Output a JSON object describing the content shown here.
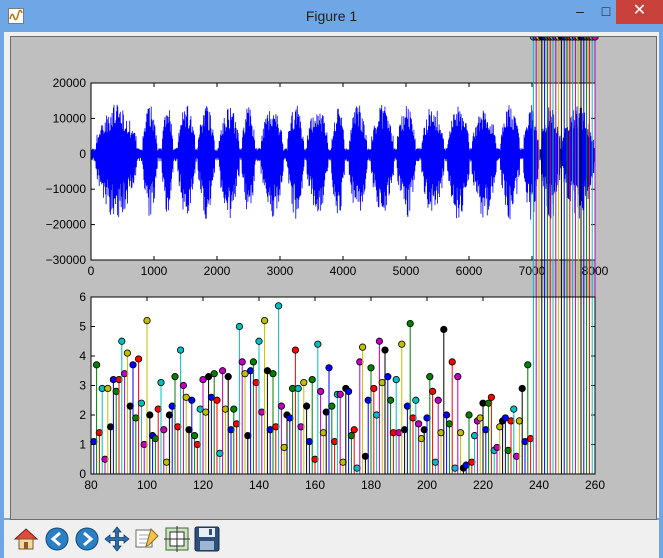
{
  "window": {
    "title": "Figure 1",
    "minimize": "–",
    "maximize": "□",
    "close": "✕"
  },
  "toolbar": {
    "buttons": [
      {
        "name": "home-button",
        "icon": "home-icon"
      },
      {
        "name": "back-button",
        "icon": "arrow-left-icon"
      },
      {
        "name": "forward-button",
        "icon": "arrow-right-icon"
      },
      {
        "name": "pan-button",
        "icon": "pan-cross-icon"
      },
      {
        "name": "zoom-button",
        "icon": "zoom-rect-icon"
      },
      {
        "name": "subplots-button",
        "icon": "subplots-icon"
      },
      {
        "name": "save-button",
        "icon": "floppy-disk-icon"
      }
    ]
  },
  "chart_data": [
    {
      "type": "line",
      "title": "",
      "xlabel": "",
      "ylabel": "",
      "xlim": [
        0,
        8000
      ],
      "ylim": [
        -30000,
        20000
      ],
      "xticks": [
        0,
        1000,
        2000,
        3000,
        4000,
        5000,
        6000,
        7000,
        8000
      ],
      "yticks": [
        20000,
        10000,
        0,
        -10000,
        -20000,
        -30000
      ],
      "xtick_labels": [
        "0",
        "1000",
        "2000",
        "3000",
        "4000",
        "5000",
        "6000",
        "7000",
        "8000"
      ],
      "ytick_labels": [
        "20000",
        "10000",
        "0",
        "−10000",
        "−20000",
        "−30000"
      ],
      "series": [
        {
          "color": "#0000ff"
        }
      ],
      "envelope_notes": "audio waveform roughly within −27000 to 15000 across 8000 samples",
      "grid": false
    },
    {
      "type": "scatter",
      "title": "",
      "xlabel": "",
      "ylabel": "",
      "xlim": [
        80,
        260
      ],
      "ylim": [
        0,
        6
      ],
      "xticks": [
        80,
        100,
        120,
        140,
        160,
        180,
        200,
        220,
        240,
        260
      ],
      "yticks": [
        0,
        1,
        2,
        3,
        4,
        5,
        6
      ],
      "xtick_labels": [
        "80",
        "100",
        "120",
        "140",
        "160",
        "180",
        "200",
        "220",
        "240",
        "260"
      ],
      "ytick_labels": [
        "0",
        "1",
        "2",
        "3",
        "4",
        "5",
        "6"
      ],
      "marker": "stem",
      "x": [
        81,
        82,
        83,
        84,
        85,
        86,
        87,
        88,
        89,
        90,
        91,
        92,
        93,
        94,
        95,
        96,
        97,
        98,
        99,
        100,
        101,
        102,
        103,
        104,
        105,
        106,
        107,
        108,
        109,
        110,
        111,
        112,
        113,
        114,
        115,
        116,
        117,
        118,
        119,
        120,
        121,
        122,
        123,
        124,
        125,
        126,
        127,
        128,
        129,
        130,
        131,
        132,
        133,
        134,
        135,
        136,
        137,
        138,
        139,
        140,
        141,
        142,
        143,
        144,
        145,
        146,
        147,
        148,
        149,
        150,
        151,
        152,
        153,
        154,
        155,
        156,
        157,
        158,
        159,
        160,
        161,
        162,
        163,
        164,
        165,
        166,
        167,
        168,
        169,
        170,
        171,
        172,
        173,
        174,
        175,
        176,
        177,
        178,
        179,
        180,
        181,
        182,
        183,
        184,
        185,
        186,
        187,
        188,
        189,
        190,
        191,
        192,
        193,
        194,
        195,
        196,
        197,
        198,
        199,
        200,
        201,
        202,
        203,
        204,
        205,
        206,
        207,
        208,
        209,
        210,
        211,
        212,
        213,
        214,
        215,
        216,
        217,
        218,
        219,
        220,
        221,
        222,
        223,
        224,
        225,
        226,
        227,
        228,
        229,
        230,
        231,
        232,
        233,
        234,
        235,
        236,
        237,
        238,
        239,
        240,
        241,
        242,
        243,
        244,
        245,
        246,
        247,
        248,
        249,
        250,
        251,
        252,
        253,
        254,
        255,
        256,
        257,
        258,
        259,
        260
      ],
      "values": [
        1.1,
        3.7,
        1.4,
        2.9,
        0.5,
        2.9,
        1.6,
        3.2,
        2.8,
        3.2,
        4.5,
        3.4,
        4.1,
        2.3,
        3.7,
        1.9,
        3.9,
        2.4,
        1.0,
        5.2,
        2.0,
        1.3,
        1.2,
        2.2,
        3.1,
        1.5,
        0.4,
        2.0,
        2.3,
        3.3,
        1.6,
        4.2,
        3.0,
        2.6,
        1.5,
        2.5,
        1.3,
        1.0,
        2.2,
        3.2,
        2.1,
        3.3,
        2.6,
        3.4,
        2.5,
        0.7,
        3.5,
        2.2,
        3.3,
        1.5,
        2.2,
        1.7,
        5.0,
        3.8,
        3.4,
        1.3,
        3.5,
        3.8,
        3.1,
        4.5,
        2.1,
        5.2,
        3.5,
        1.5,
        3.4,
        1.6,
        5.7,
        2.3,
        0.9,
        2.0,
        1.9,
        2.9,
        4.2,
        2.9,
        1.6,
        3.1,
        2.3,
        1.1,
        3.2,
        0.5,
        4.4,
        2.8,
        1.4,
        2.1,
        3.6,
        2.3,
        1.1,
        2.7,
        2.7,
        0.4,
        2.9,
        2.8,
        1.3,
        1.5,
        0.2,
        3.8,
        4.3,
        0.6,
        2.5,
        3.6,
        2.9,
        2.0,
        4.5,
        3.1,
        4.2,
        3.3,
        2.5,
        1.4,
        3.2,
        1.4,
        4.4,
        1.5,
        2.3,
        5.1,
        1.9,
        2.5,
        1.7,
        1.2,
        1.5,
        1.9,
        3.3,
        2.8,
        0.4,
        2.5,
        1.4,
        4.9,
        2.0,
        1.7,
        3.8,
        0.2,
        3.3,
        1.4,
        0.2,
        0.3,
        2.0,
        0.4,
        1.3,
        1.8,
        1.9,
        2.4,
        1.5,
        2.4,
        2.6,
        0.8,
        0.9,
        1.6,
        1.8,
        1.9,
        0.8,
        1.8,
        2.2,
        0.6,
        1.8,
        2.9,
        1.1,
        3.7,
        1.2
      ]
    }
  ]
}
